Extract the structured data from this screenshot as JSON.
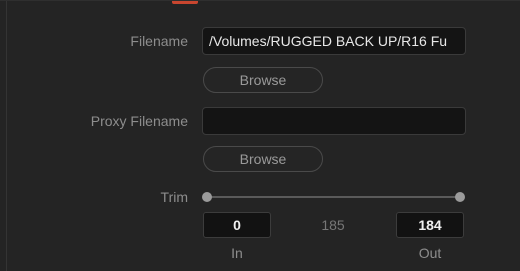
{
  "filename": {
    "label": "Filename",
    "value": "/Volumes/RUGGED BACK UP/R16 Fu"
  },
  "browse_button_1": "Browse",
  "proxy": {
    "label": "Proxy Filename",
    "value": ""
  },
  "browse_button_2": "Browse",
  "trim": {
    "label": "Trim",
    "in_value": "0",
    "total": "185",
    "out_value": "184",
    "in_label": "In",
    "out_label": "Out"
  }
}
